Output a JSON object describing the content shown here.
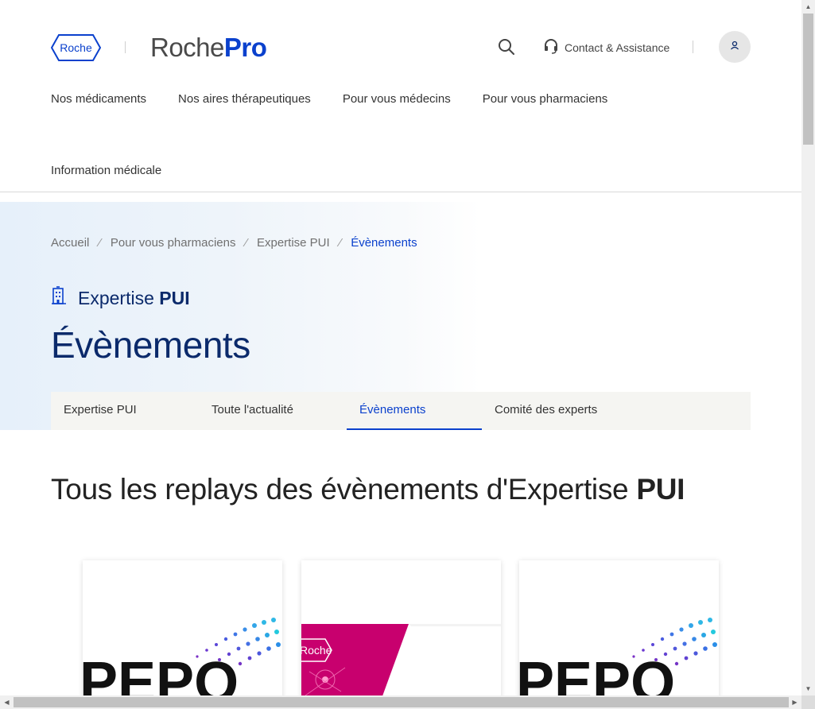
{
  "header": {
    "logo_text": "Roche",
    "brand_left": "Roche",
    "brand_right": "Pro",
    "contact_label": "Contact & Assistance"
  },
  "nav": {
    "items": [
      "Nos médicaments",
      "Nos aires thérapeutiques",
      "Pour vous médecins",
      "Pour vous pharmaciens"
    ],
    "second_row": "Information médicale"
  },
  "breadcrumb": [
    "Accueil",
    "Pour vous pharmaciens",
    "Expertise PUI",
    "Évènements"
  ],
  "section": {
    "label_regular": "Expertise",
    "label_bold": "PUI"
  },
  "page_title": "Évènements",
  "tabs": [
    "Expertise PUI",
    "Toute l'actualité",
    "Évènements",
    "Comité des experts"
  ],
  "active_tab": "Évènements",
  "heading": {
    "regular": "Tous les replays des évènements d'Expertise",
    "bold": "PUI"
  },
  "cards": [
    {
      "art_text": "PEPO",
      "art_style": "dotted-wave"
    },
    {
      "art_text": "Roche",
      "art_style": "magenta-banner"
    },
    {
      "art_text": "PEPO",
      "art_style": "dotted-wave"
    }
  ],
  "colors": {
    "accent": "#0b41cd",
    "title": "#0b2a6b",
    "magenta": "#c8006e"
  }
}
